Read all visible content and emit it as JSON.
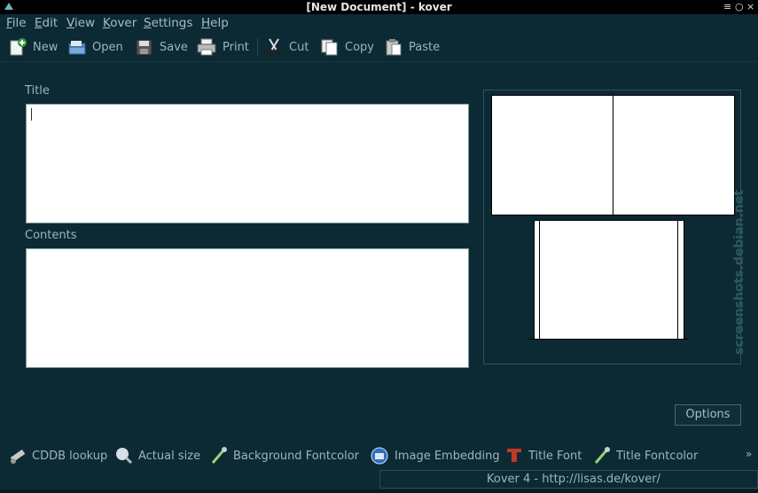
{
  "window": {
    "title": "[New Document] - kover",
    "buttons": [
      "≡",
      "○",
      "×"
    ]
  },
  "menu": [
    {
      "first": "F",
      "rest": "ile"
    },
    {
      "first": "E",
      "rest": "dit"
    },
    {
      "first": "V",
      "rest": "iew"
    },
    {
      "first": "K",
      "rest": "over"
    },
    {
      "first": "S",
      "rest": "ettings"
    },
    {
      "first": "H",
      "rest": "elp"
    }
  ],
  "toolbar": {
    "new": "New",
    "open": "Open",
    "save": "Save",
    "print": "Print",
    "cut": "Cut",
    "copy": "Copy",
    "paste": "Paste"
  },
  "form": {
    "title_label": "Title",
    "title_value": "",
    "contents_label": "Contents",
    "contents_value": ""
  },
  "options_label": "Options",
  "bottombar": {
    "cddb": "CDDB lookup",
    "actual_size": "Actual size",
    "bg_fontcolor": "Background Fontcolor",
    "image_embedding": "Image Embedding",
    "title_font": "Title Font",
    "title_fontcolor": "Title Fontcolor",
    "more": "»"
  },
  "status": "Kover 4 - http://lisas.de/kover/",
  "watermark": "screenshots.debian.net"
}
